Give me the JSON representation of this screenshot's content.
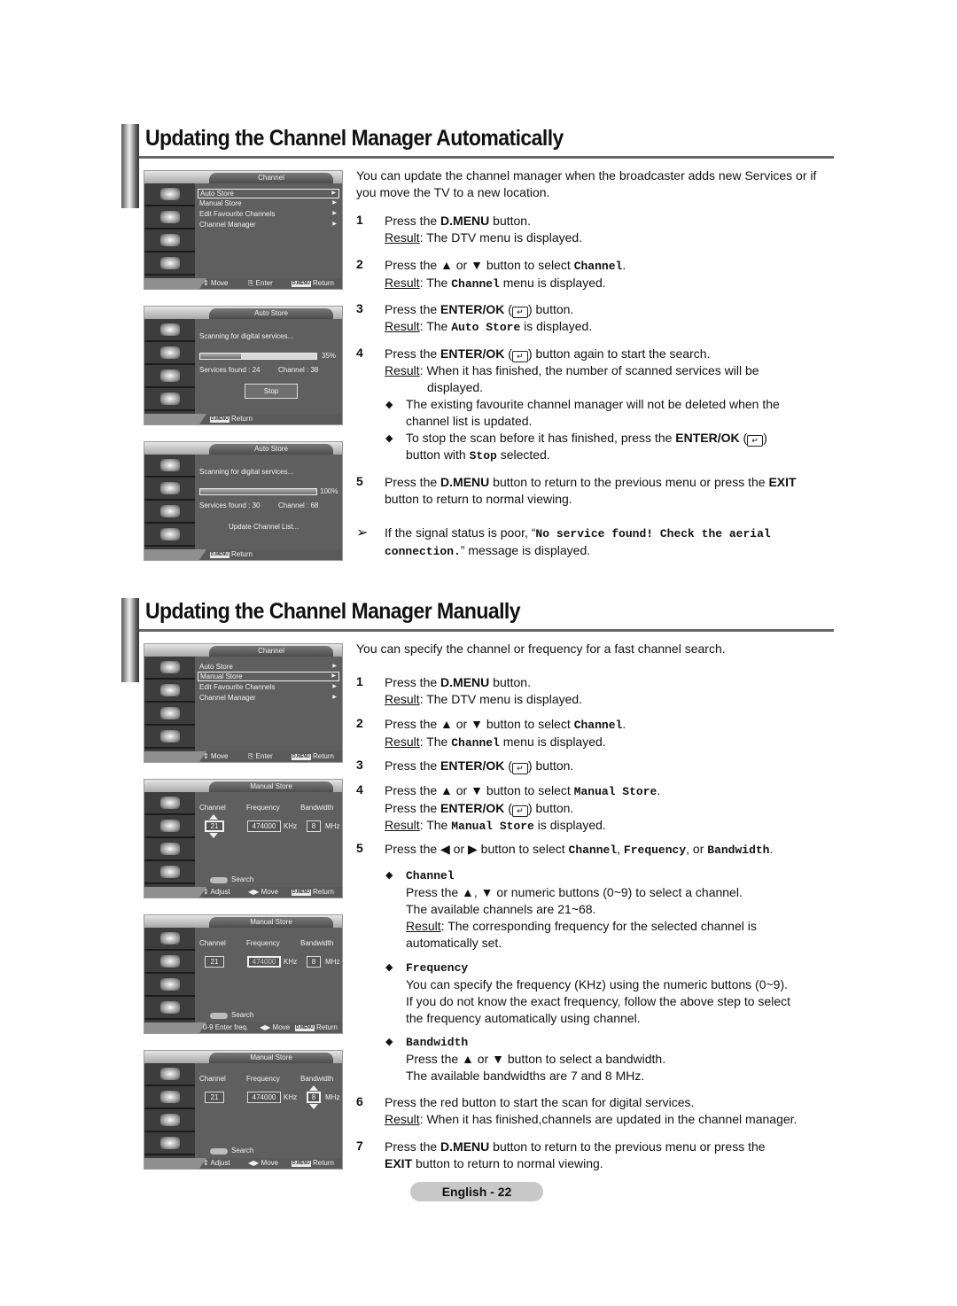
{
  "sections": [
    {
      "title": "Updating the Channel Manager Automatically",
      "intro": "You can update the channel manager when the broadcaster adds new Services or if you move the TV to a new location.",
      "steps": {
        "s1": {
          "num": "1",
          "pre": "Press the ",
          "bold": "D.MENU",
          "post": " button.",
          "result_label": "Result",
          "result": ": The DTV menu is displayed."
        },
        "s2": {
          "num": "2",
          "pre": "Press the ▲ or ▼ button to select ",
          "mono": "Channel",
          "post": ".",
          "result_label": "Result",
          "result_pre": ": The ",
          "result_mono": "Channel",
          "result_post": " menu is displayed."
        },
        "s3": {
          "num": "3",
          "pre": "Press the ",
          "bold": "ENTER/OK",
          "post": " button.",
          "result_label": "Result",
          "result_pre": ": The ",
          "result_mono": "Auto Store",
          "result_post": " is displayed."
        },
        "s4": {
          "num": "4",
          "pre": "Press the ",
          "bold": "ENTER/OK",
          "post": " button again to start the search.",
          "result_label": "Result",
          "result": ": When it has finished, the number of scanned services will be",
          "result_cont": "displayed.",
          "bullet1": "The existing favourite channel manager will not be deleted when the",
          "bullet1_cont": "channel list is updated.",
          "bullet2_pre": "To stop the scan before it has finished, press the ",
          "bullet2_bold": "ENTER/OK",
          "bullet2_cont_pre": "button with ",
          "bullet2_mono": "Stop",
          "bullet2_cont_post": " selected."
        },
        "s5": {
          "num": "5",
          "pre": "Press the ",
          "bold": "D.MENU",
          "mid": " button to return to the previous menu or press the ",
          "bold2": "EXIT",
          "cont": "button  to return to normal viewing."
        },
        "note": {
          "pre": "If the signal status is poor, “",
          "mono": "No service found! Check the aerial",
          "mono_cont": "connection.",
          "post": "” message is displayed."
        }
      }
    },
    {
      "title": "Updating the Channel Manager Manually",
      "intro": "You can specify the channel or frequency for a fast channel search.",
      "steps": {
        "s1": {
          "num": "1",
          "pre": "Press the ",
          "bold": "D.MENU",
          "post": " button.",
          "result_label": "Result",
          "result": ": The DTV menu is displayed."
        },
        "s2": {
          "num": "2",
          "pre": "Press the ▲ or ▼ button to select ",
          "mono": "Channel",
          "post": ".",
          "result_label": "Result",
          "result_pre": ": The ",
          "result_mono": "Channel",
          "result_post": " menu is displayed."
        },
        "s3": {
          "num": "3",
          "pre": "Press the ",
          "bold": "ENTER/OK",
          "post": " button."
        },
        "s4": {
          "num": "4",
          "pre": "Press the ▲ or ▼ button to select ",
          "mono": "Manual Store",
          "post": ".",
          "line2_pre": "Press the ",
          "line2_bold": "ENTER/OK",
          "line2_post": " button.",
          "result_label": "Result",
          "result_pre": ": The ",
          "result_mono": "Manual Store",
          "result_post": " is displayed."
        },
        "s5": {
          "num": "5",
          "pre": "Press the ◀ or ▶ button to select ",
          "m1": "Channel",
          "c1": ", ",
          "m2": "Frequency",
          "c2": ", or ",
          "m3": "Bandwidth",
          "post": ".",
          "channel_head": "Channel",
          "channel_l1": "Press the ▲, ▼ or numeric buttons (0~9) to select a channel.",
          "channel_l2": "The available channels are 21~68.",
          "channel_result_label": "Result",
          "channel_result": ": The corresponding frequency for the selected channel is",
          "channel_result_cont": "automatically set.",
          "freq_head": "Frequency",
          "freq_l1": "You can specify the frequency (KHz) using the numeric buttons (0~9).",
          "freq_l2": "If you do not know the exact frequency, follow the above step to select",
          "freq_l3": "the frequency automatically using channel.",
          "bw_head": "Bandwidth",
          "bw_l1": "Press the ▲ or ▼ button to select a bandwidth.",
          "bw_l2": "The available bandwidths are 7 and 8 MHz."
        },
        "s6": {
          "num": "6",
          "text": "Press the red button to start the scan for digital services.",
          "result_label": "Result",
          "result": ": When it has finished,channels are updated in the channel manager."
        },
        "s7": {
          "num": "7",
          "pre": "Press the ",
          "bold": "D.MENU",
          "post": " button to return to the previous menu or press the",
          "cont_bold": "EXIT",
          "cont": " button to return to normal viewing."
        }
      }
    }
  ],
  "enter_icon": "↵",
  "note_icon": "➢",
  "bullet_icon": "◆",
  "osd": {
    "channel_menu": {
      "title": "Channel",
      "items": [
        "Auto Store",
        "Manual Store",
        "Edit Favourite Channels",
        "Channel Manager"
      ],
      "arrow": "▶",
      "hint_move": "⇕ Move",
      "hint_enter": "⎘ Enter",
      "hint_dmenu": "D.MENU",
      "hint_return": "Return"
    },
    "auto_store_35": {
      "title": "Auto Store",
      "scanning": "Scanning for digital services...",
      "progress_percent": 35,
      "progress_label": "35%",
      "services_found": "Services found : 24",
      "channel": "Channel : 38",
      "stop": "Stop",
      "return": "Return"
    },
    "auto_store_100": {
      "title": "Auto Store",
      "scanning": "Scanning for digital services...",
      "progress_percent": 100,
      "progress_label": "100%",
      "services_found": "Services found : 30",
      "channel": "Channel : 68",
      "update": "Update Channel List...",
      "return": "Return"
    },
    "manual_store": {
      "title": "Manual Store",
      "col_channel": "Channel",
      "col_frequency": "Frequency",
      "col_bandwidth": "Bandwidth",
      "channel_value": "21",
      "frequency_value": "474000",
      "frequency_unit": "KHz",
      "bandwidth_value": "8",
      "bandwidth_unit": "MHz",
      "search": "Search",
      "hint_adjust": "⇕ Adjust",
      "hint_move": "◀▶ Move",
      "hint_enter_freq": "0-9 Enter freq.",
      "return": "Return"
    }
  },
  "footer": {
    "page_label": "English - 22"
  }
}
